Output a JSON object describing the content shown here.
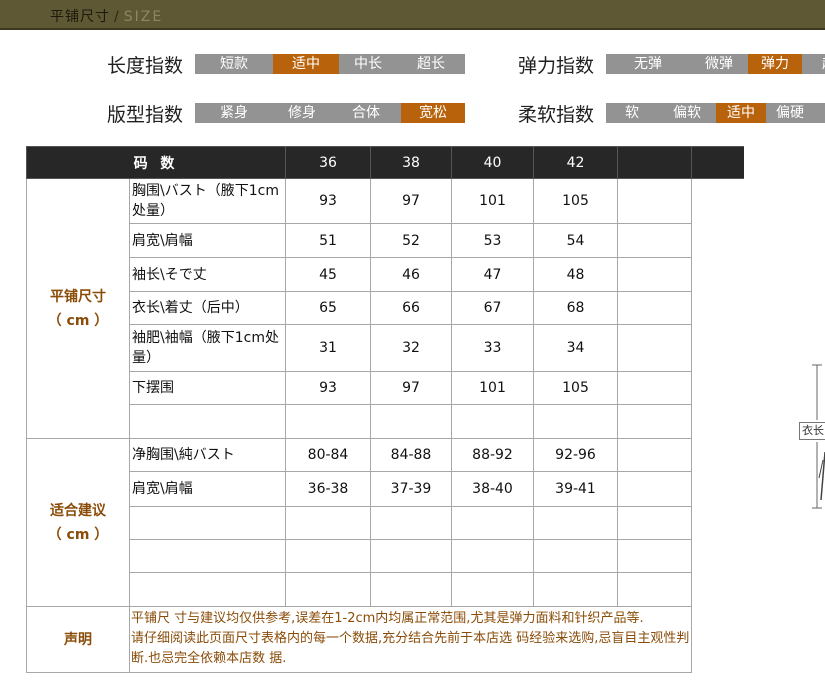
{
  "header": {
    "title": "平铺尺寸",
    "separator": "/",
    "size_en": "SIZE"
  },
  "indices": {
    "length": {
      "label": "长度指数",
      "options": [
        "短款",
        "适中",
        "中长",
        "超长"
      ],
      "selected": "适中"
    },
    "elasticity": {
      "label": "弹力指数",
      "options": [
        "无弹",
        "微弹",
        "弹力",
        "超"
      ],
      "selected": "弹力"
    },
    "fit": {
      "label": "版型指数",
      "options": [
        "紧身",
        "修身",
        "合体",
        "宽松"
      ],
      "selected": "宽松"
    },
    "softness": {
      "label": "柔软指数",
      "options": [
        "软",
        "偏软",
        "适中",
        "偏硬"
      ],
      "selected": "适中"
    }
  },
  "table": {
    "header_label": "码 数",
    "sizes": [
      "36",
      "38",
      "40",
      "42"
    ],
    "flat_group": {
      "label_line1": "平铺尺寸",
      "label_line2": "（ cm ）"
    },
    "flat_rows": [
      {
        "label": "胸围\\バスト（腋下1cm处量）",
        "values": [
          "93",
          "97",
          "101",
          "105"
        ]
      },
      {
        "label": "肩宽\\肩幅",
        "values": [
          "51",
          "52",
          "53",
          "54"
        ]
      },
      {
        "label": "袖长\\そで丈",
        "values": [
          "45",
          "46",
          "47",
          "48"
        ]
      },
      {
        "label": "衣长\\着丈（后中）",
        "values": [
          "65",
          "66",
          "67",
          "68"
        ]
      },
      {
        "label": "袖肥\\袖幅（腋下1cm处量）",
        "values": [
          "31",
          "32",
          "33",
          "34"
        ]
      },
      {
        "label": "下摆围",
        "values": [
          "93",
          "97",
          "101",
          "105"
        ]
      }
    ],
    "fit_group": {
      "label_line1": "适合建议",
      "label_line2": "（ cm ）"
    },
    "fit_rows": [
      {
        "label": "净胸围\\純バスト",
        "values": [
          "80-84",
          "84-88",
          "88-92",
          "92-96"
        ]
      },
      {
        "label": "肩宽\\肩幅",
        "values": [
          "36-38",
          "37-39",
          "38-40",
          "39-41"
        ]
      }
    ],
    "statement": {
      "label": "声明",
      "line1": "平铺尺 寸与建议均仅供参考,误差在1-2cm内均属正常范围,尤其是弹力面料和针织产品等.",
      "line2": "请仔细阅读此页面尺寸表格内的每一个数据,充分结合先前于本店选 码经验来选购,忌盲目主观性判断.也忌完全依赖本店数 据."
    }
  },
  "side_illustration": {
    "tag_text": "衣长"
  },
  "colors": {
    "accent": "#b8620b",
    "header_bar": "#5f5834",
    "table_header": "#272727",
    "group_text": "#8a4c08"
  }
}
